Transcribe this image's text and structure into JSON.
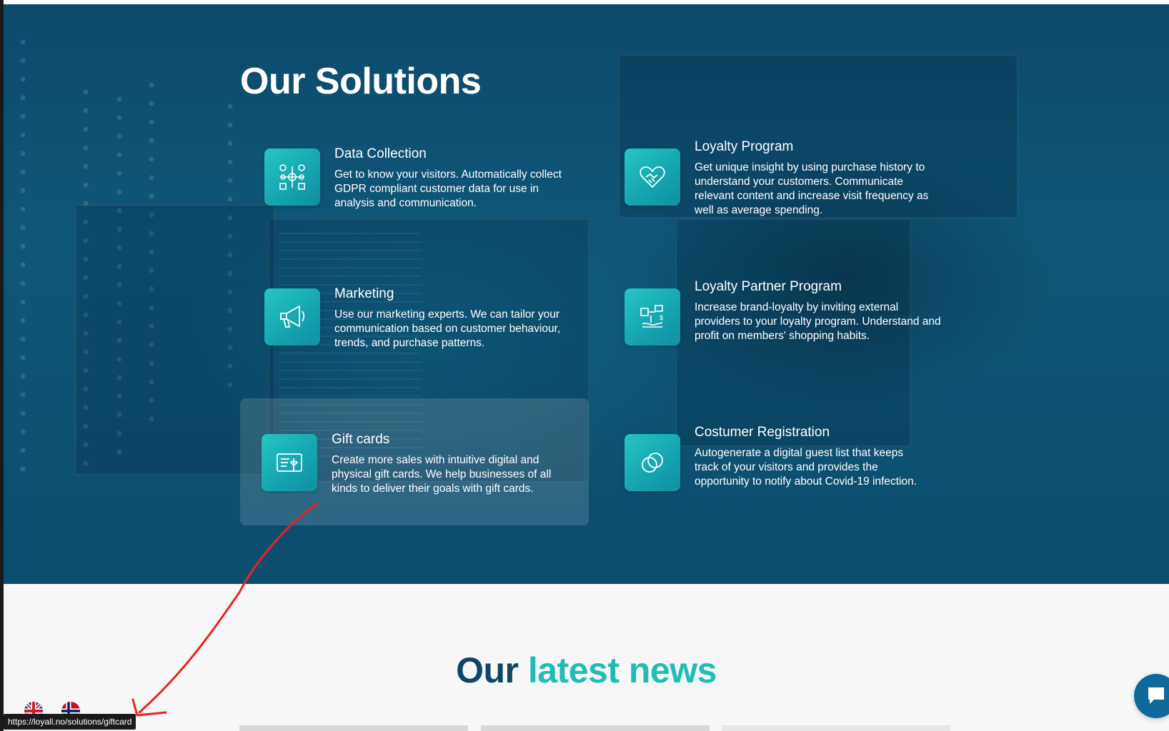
{
  "hero": {
    "title": "Our Solutions"
  },
  "solutions": [
    {
      "title": "Data Collection",
      "description": "Get to know your visitors. Automatically collect GDPR compliant customer data for use in analysis and communication.",
      "icon": "data-network-icon"
    },
    {
      "title": "Loyalty Program",
      "description": "Get unique insight by using purchase history to understand your customers. Communicate relevant content and increase visit frequency as well as average spending.",
      "icon": "heart-handshake-icon"
    },
    {
      "title": "Marketing",
      "description": "Use our marketing experts. We can tailor your communication based on customer behaviour, trends, and purchase patterns.",
      "icon": "megaphone-icon"
    },
    {
      "title": "Loyalty Partner Program",
      "description": "Increase brand-loyalty by inviting external providers to your loyalty program. Understand and profit on members' shopping habits.",
      "icon": "partner-exchange-icon"
    },
    {
      "title": "Gift cards",
      "description": "Create more sales with intuitive digital and physical gift cards. We help businesses of all kinds to deliver their goals with gift cards.",
      "icon": "gift-card-icon"
    },
    {
      "title": "Costumer Registration",
      "description": "Autogenerate a digital guest list that keeps track of your visitors and provides the opportunity to notify about Covid-19 infection.",
      "icon": "linked-rings-icon"
    }
  ],
  "news": {
    "title_part1": "Our ",
    "title_part2": "latest news"
  },
  "status_bar": {
    "url": "https://loyall.no/solutions/giftcard"
  },
  "languages": [
    "uk-flag-icon",
    "norway-flag-icon"
  ],
  "colors": {
    "hero_bg": "#0e5678",
    "icon_teal": "#1fbdb4",
    "news_dark": "#0c4766",
    "news_accent": "#1fbdb4",
    "annotation_red": "#e8241c"
  }
}
